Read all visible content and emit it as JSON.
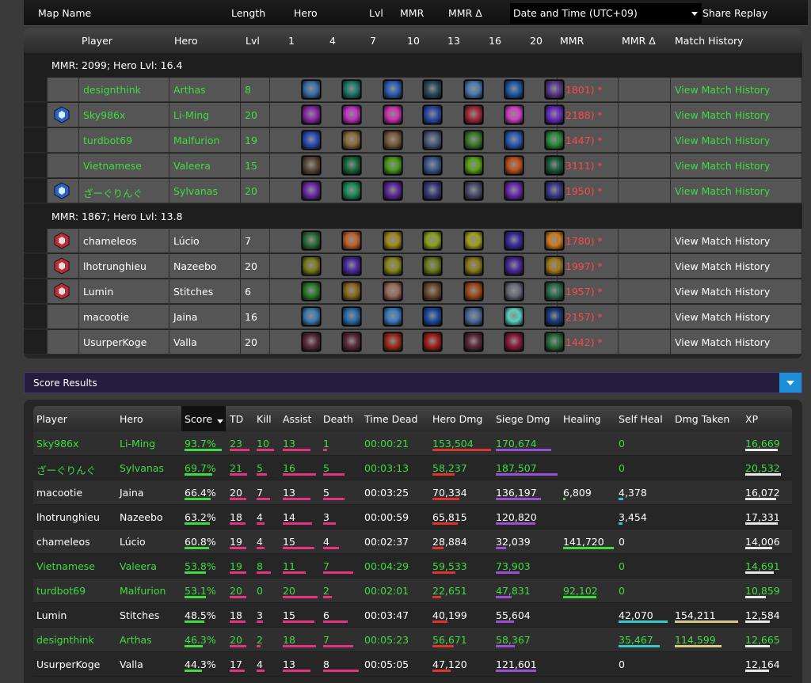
{
  "top_header": {
    "map_name": "Map Name",
    "length": "Length",
    "hero": "Hero",
    "lvl": "Lvl",
    "mmr": "MMR",
    "mmr_delta": "MMR Δ",
    "date_select": "Date and Time (UTC+09)",
    "share_replay": "Share Replay"
  },
  "match_header": {
    "player": "Player",
    "hero": "Hero",
    "lvl": "Lvl",
    "tiers": [
      "1",
      "4",
      "7",
      "10",
      "13",
      "16",
      "20"
    ],
    "mmr": "MMR",
    "mmr_delta": "MMR Δ",
    "history": "Match History"
  },
  "teams": [
    {
      "summary": "MMR: 2099; Hero Lvl: 16.4",
      "players": [
        {
          "name": "designthink",
          "hero": "Arthas",
          "lvl": "8",
          "mmr": "(1801) *",
          "history": "View Match History",
          "color": "green",
          "badge": "",
          "talents": [
            "#3b6fa8",
            "#1c7a6a",
            "#2b5fb8",
            "#2a4a5a",
            "#4a7ab0",
            "#1c5aa8",
            "#5a3a8a"
          ]
        },
        {
          "name": "Sky986x",
          "hero": "Li-Ming",
          "lvl": "20",
          "mmr": "(2188) *",
          "history": "View Match History",
          "color": "green",
          "badge": "hex-blue",
          "talents": [
            "#8a2aa8",
            "#c030c0",
            "#d030b0",
            "#2a4aa8",
            "#a02a3a",
            "#d040c0",
            "#6a2ac0"
          ]
        },
        {
          "name": "turdbot69",
          "hero": "Malfurion",
          "lvl": "19",
          "mmr": "(1447) *",
          "history": "View Match History",
          "color": "green",
          "badge": "",
          "talents": [
            "#2a4ab8",
            "#8a6a3a",
            "#7a5a3a",
            "#4a5a7a",
            "#3a7a2a",
            "#2a5ab8",
            "#2a8a3a"
          ]
        },
        {
          "name": "Vietnamese",
          "hero": "Valeera",
          "lvl": "15",
          "mmr": "(3111) *",
          "history": "View Match History",
          "color": "green",
          "badge": "",
          "talents": [
            "#5a4a3a",
            "#1a6a3a",
            "#4a9a1a",
            "#3a5a8a",
            "#5aa01a",
            "#c0501a",
            "#1a5a3a"
          ]
        },
        {
          "name": "ざーぐりんぐ",
          "hero": "Sylvanas",
          "lvl": "20",
          "mmr": "(1950) *",
          "history": "View Match History",
          "color": "green",
          "badge": "tower-blue",
          "talents": [
            "#6a2aa8",
            "#1a8a5a",
            "#5a2a9a",
            "#3a3a7a",
            "#4a4a6a",
            "#6a2ab0",
            "#3a3a8a"
          ]
        }
      ]
    },
    {
      "summary": "MMR: 1867; Hero Lvl: 13.8",
      "players": [
        {
          "name": "chameleos",
          "hero": "Lúcio",
          "lvl": "7",
          "mmr": "(1780) *",
          "history": "View Match History",
          "color": "white",
          "badge": "hex-red",
          "talents": [
            "#2a6a3a",
            "#c0602a",
            "#a08a1a",
            "#8aa01a",
            "#a0a01a",
            "#3a2aa0",
            "#d07a1a"
          ]
        },
        {
          "name": "lhotrunghieu",
          "hero": "Nazeebo",
          "lvl": "20",
          "mmr": "(1997) *",
          "history": "View Match History",
          "color": "white",
          "badge": "hex-red2",
          "talents": [
            "#7a7a1a",
            "#4a2aa0",
            "#8a8a1a",
            "#6a7a1a",
            "#8a7a1a",
            "#4a2a9a",
            "#a07a1a"
          ]
        },
        {
          "name": "Lumin",
          "hero": "Stitches",
          "lvl": "6",
          "mmr": "(1957) *",
          "history": "View Match History",
          "color": "white",
          "badge": "hex-red3",
          "talents": [
            "#2a7a2a",
            "#8a6a1a",
            "#9a6a5a",
            "#6a4a2a",
            "#a04a1a",
            "#6a6a7a",
            "#2a6a4a"
          ]
        },
        {
          "name": "macootie",
          "hero": "Jaina",
          "lvl": "16",
          "mmr": "(2157) *",
          "history": "View Match History",
          "color": "white",
          "badge": "",
          "talents": [
            "#3a7ab0",
            "#2a6aa8",
            "#3a7ac0",
            "#1a4aa0",
            "#4a6a9a",
            "#5ad0c0",
            "#1a3a7a"
          ]
        },
        {
          "name": "UsurperKoge",
          "hero": "Valla",
          "lvl": "20",
          "mmr": "(1442) *",
          "history": "View Match History",
          "color": "white",
          "badge": "",
          "talents": [
            "#5a2a3a",
            "#5a2a3a",
            "#a02a1a",
            "#a0201a",
            "#5a2a3a",
            "#8a1a3a",
            "#2a6a3a"
          ]
        }
      ]
    }
  ],
  "score_toggle": {
    "label": "Score Results"
  },
  "score_header": {
    "player": "Player",
    "hero": "Hero",
    "score": "Score",
    "td": "TD",
    "kill": "Kill",
    "assist": "Assist",
    "death": "Death",
    "time_dead": "Time Dead",
    "hero_dmg": "Hero Dmg",
    "siege_dmg": "Siege Dmg",
    "healing": "Healing",
    "self_heal": "Self Heal",
    "dmg_taken": "Dmg Taken",
    "xp": "XP"
  },
  "score_rows": [
    {
      "player": "Sky986x",
      "hero": "Li-Ming",
      "score": "93.7%",
      "td": "23",
      "kill": "10",
      "assist": "13",
      "death": "1",
      "time_dead": "00:00:21",
      "hero_dmg": "153,504",
      "siege_dmg": "170,674",
      "healing": "",
      "self_heal": "0",
      "dmg_taken": "",
      "xp": "16,669",
      "color": "green",
      "fill": {
        "score": 0.94,
        "td": 0.95,
        "kill": 0.85,
        "assist": 0.8,
        "death": 0.12,
        "hero_dmg": 1.0,
        "siege_dmg": 0.9,
        "healing": 0,
        "self_heal": 0,
        "dmg_taken": 0,
        "xp": 0.9
      }
    },
    {
      "player": "ざーぐりんぐ",
      "hero": "Sylvanas",
      "score": "69.7%",
      "td": "21",
      "kill": "5",
      "assist": "16",
      "death": "5",
      "time_dead": "00:03:13",
      "hero_dmg": "58,237",
      "siege_dmg": "187,507",
      "healing": "",
      "self_heal": "0",
      "dmg_taken": "",
      "xp": "20,532",
      "color": "green",
      "fill": {
        "score": 0.7,
        "td": 0.85,
        "kill": 0.5,
        "assist": 0.95,
        "death": 0.6,
        "hero_dmg": 0.38,
        "siege_dmg": 1.0,
        "healing": 0,
        "self_heal": 0,
        "dmg_taken": 0,
        "xp": 1.0
      }
    },
    {
      "player": "macootie",
      "hero": "Jaina",
      "score": "66.4%",
      "td": "20",
      "kill": "7",
      "assist": "13",
      "death": "5",
      "time_dead": "00:03:25",
      "hero_dmg": "70,334",
      "siege_dmg": "136,197",
      "healing": "6,809",
      "self_heal": "4,378",
      "dmg_taken": "",
      "xp": "16,072",
      "color": "white",
      "fill": {
        "score": 0.66,
        "td": 0.82,
        "kill": 0.65,
        "assist": 0.8,
        "death": 0.6,
        "hero_dmg": 0.46,
        "siege_dmg": 0.73,
        "healing": 0.05,
        "self_heal": 0.1,
        "dmg_taken": 0,
        "xp": 0.86
      }
    },
    {
      "player": "lhotrunghieu",
      "hero": "Nazeebo",
      "score": "63.2%",
      "td": "18",
      "kill": "4",
      "assist": "14",
      "death": "3",
      "time_dead": "00:00:59",
      "hero_dmg": "65,815",
      "siege_dmg": "120,820",
      "healing": "",
      "self_heal": "3,454",
      "dmg_taken": "",
      "xp": "17,331",
      "color": "white",
      "fill": {
        "score": 0.63,
        "td": 0.75,
        "kill": 0.4,
        "assist": 0.85,
        "death": 0.35,
        "hero_dmg": 0.43,
        "siege_dmg": 0.64,
        "healing": 0,
        "self_heal": 0.08,
        "dmg_taken": 0,
        "xp": 0.92
      }
    },
    {
      "player": "chameleos",
      "hero": "Lúcio",
      "score": "60.8%",
      "td": "19",
      "kill": "4",
      "assist": "15",
      "death": "4",
      "time_dead": "00:02:37",
      "hero_dmg": "28,884",
      "siege_dmg": "32,039",
      "healing": "141,720",
      "self_heal": "0",
      "dmg_taken": "",
      "xp": "14,006",
      "color": "white",
      "fill": {
        "score": 0.61,
        "td": 0.8,
        "kill": 0.4,
        "assist": 0.9,
        "death": 0.45,
        "hero_dmg": 0.19,
        "siege_dmg": 0.17,
        "healing": 1.0,
        "self_heal": 0,
        "dmg_taken": 0,
        "xp": 0.75
      }
    },
    {
      "player": "Vietnamese",
      "hero": "Valeera",
      "score": "53.8%",
      "td": "19",
      "kill": "8",
      "assist": "11",
      "death": "7",
      "time_dead": "00:04:29",
      "hero_dmg": "59,533",
      "siege_dmg": "73,903",
      "healing": "",
      "self_heal": "0",
      "dmg_taken": "",
      "xp": "14,691",
      "color": "green",
      "fill": {
        "score": 0.54,
        "td": 0.8,
        "kill": 0.7,
        "assist": 0.65,
        "death": 0.85,
        "hero_dmg": 0.39,
        "siege_dmg": 0.39,
        "healing": 0,
        "self_heal": 0,
        "dmg_taken": 0,
        "xp": 0.8
      }
    },
    {
      "player": "turdbot69",
      "hero": "Malfurion",
      "score": "53.1%",
      "td": "20",
      "kill": "0",
      "assist": "20",
      "death": "2",
      "time_dead": "00:02:01",
      "hero_dmg": "22,651",
      "siege_dmg": "47,831",
      "healing": "92,102",
      "self_heal": "0",
      "dmg_taken": "",
      "xp": "10,859",
      "color": "green",
      "fill": {
        "score": 0.53,
        "td": 0.82,
        "kill": 0,
        "assist": 1.0,
        "death": 0.25,
        "hero_dmg": 0.15,
        "siege_dmg": 0.26,
        "healing": 0.65,
        "self_heal": 0,
        "dmg_taken": 0,
        "xp": 0.58
      }
    },
    {
      "player": "Lumin",
      "hero": "Stitches",
      "score": "48.5%",
      "td": "18",
      "kill": "3",
      "assist": "15",
      "death": "6",
      "time_dead": "00:03:47",
      "hero_dmg": "40,199",
      "siege_dmg": "55,604",
      "healing": "",
      "self_heal": "42,070",
      "dmg_taken": "154,211",
      "xp": "12,584",
      "color": "white",
      "fill": {
        "score": 0.49,
        "td": 0.75,
        "kill": 0.3,
        "assist": 0.9,
        "death": 0.7,
        "hero_dmg": 0.26,
        "siege_dmg": 0.3,
        "healing": 0,
        "self_heal": 1.0,
        "dmg_taken": 1.0,
        "xp": 0.68
      }
    },
    {
      "player": "designthink",
      "hero": "Arthas",
      "score": "46.3%",
      "td": "20",
      "kill": "2",
      "assist": "18",
      "death": "7",
      "time_dead": "00:05:23",
      "hero_dmg": "56,671",
      "siege_dmg": "58,367",
      "healing": "",
      "self_heal": "35,467",
      "dmg_taken": "114,599",
      "xp": "12,665",
      "color": "green",
      "fill": {
        "score": 0.46,
        "td": 0.82,
        "kill": 0.2,
        "assist": 0.95,
        "death": 0.85,
        "hero_dmg": 0.37,
        "siege_dmg": 0.31,
        "healing": 0,
        "self_heal": 0.84,
        "dmg_taken": 0.74,
        "xp": 0.69
      }
    },
    {
      "player": "UsurperKoge",
      "hero": "Valla",
      "score": "44.3%",
      "td": "17",
      "kill": "4",
      "assist": "13",
      "death": "8",
      "time_dead": "00:05:05",
      "hero_dmg": "47,120",
      "siege_dmg": "121,601",
      "healing": "",
      "self_heal": "0",
      "dmg_taken": "",
      "xp": "12,164",
      "color": "white",
      "fill": {
        "score": 0.44,
        "td": 0.72,
        "kill": 0.4,
        "assist": 0.8,
        "death": 1.0,
        "hero_dmg": 0.31,
        "siege_dmg": 0.65,
        "healing": 0,
        "self_heal": 0,
        "dmg_taken": 0,
        "xp": 0.66
      }
    }
  ]
}
